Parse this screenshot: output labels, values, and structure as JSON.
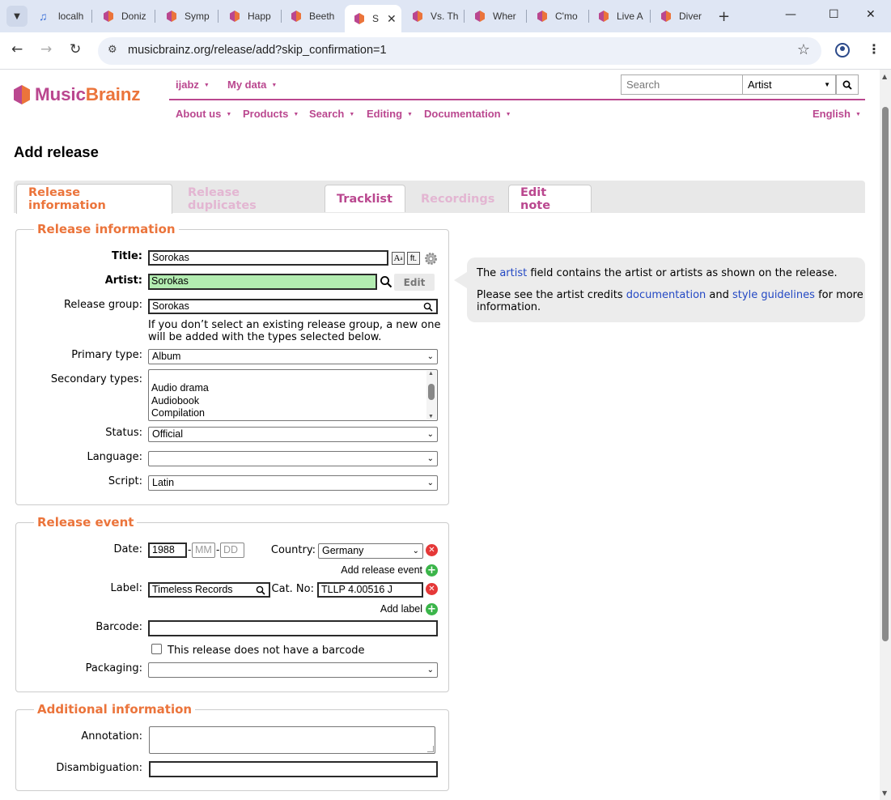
{
  "browser": {
    "tabs": [
      {
        "label": "localh",
        "icon": "music-note-icon"
      },
      {
        "label": "Doniz",
        "icon": "musicbrainz-icon"
      },
      {
        "label": "Symp",
        "icon": "musicbrainz-icon"
      },
      {
        "label": "Happ",
        "icon": "musicbrainz-icon"
      },
      {
        "label": "Beeth",
        "icon": "musicbrainz-icon"
      },
      {
        "label": "S",
        "icon": "musicbrainz-icon",
        "active": true
      },
      {
        "label": "Vs. Th",
        "icon": "musicbrainz-icon"
      },
      {
        "label": "Wher",
        "icon": "musicbrainz-icon"
      },
      {
        "label": "C'mo",
        "icon": "musicbrainz-icon"
      },
      {
        "label": "Live A",
        "icon": "musicbrainz-icon"
      },
      {
        "label": "Diver",
        "icon": "musicbrainz-icon"
      }
    ],
    "url": "musicbrainz.org/release/add?skip_confirmation=1"
  },
  "header": {
    "logo_a": "Music",
    "logo_b": "Brainz",
    "user_menu": "ijabz",
    "mydata_menu": "My data",
    "search_placeholder": "Search",
    "search_type": "Artist",
    "nav": [
      "About us",
      "Products",
      "Search",
      "Editing",
      "Documentation"
    ],
    "language": "English"
  },
  "page": {
    "title": "Add release",
    "tabs": [
      "Release information",
      "Release duplicates",
      "Tracklist",
      "Recordings",
      "Edit note"
    ]
  },
  "release_info": {
    "legend": "Release information",
    "title_label": "Title:",
    "title_value": "Sorokas",
    "artist_label": "Artist:",
    "artist_value": "Sorokas",
    "edit_button": "Edit",
    "release_group_label": "Release group:",
    "release_group_value": "Sorokas",
    "release_group_note_1": "If you don’t select an existing release group, a new one",
    "release_group_note_2": "will be added with the types selected below.",
    "primary_type_label": "Primary type:",
    "primary_type_value": "Album",
    "secondary_types_label": "Secondary types:",
    "secondary_types_options": [
      "Audio drama",
      "Audiobook",
      "Compilation"
    ],
    "status_label": "Status:",
    "status_value": "Official",
    "language_label": "Language:",
    "language_value": "",
    "script_label": "Script:",
    "script_value": "Latin"
  },
  "help_bubble": {
    "line1_a": "The",
    "line1_link": "artist",
    "line1_b": "field contains the artist or artists as shown on the release.",
    "line2_a": "Please see the artist credits",
    "line2_link1": "documentation",
    "line2_and": "and",
    "line2_link2": "style guidelines",
    "line2_b": "for more",
    "line3": "information."
  },
  "release_event": {
    "legend": "Release event",
    "date_label": "Date:",
    "year": "1988",
    "month_placeholder": "MM",
    "day_placeholder": "DD",
    "country_label": "Country:",
    "country_value": "Germany",
    "add_event": "Add release event",
    "label_label": "Label:",
    "label_value": "Timeless Records",
    "catno_label": "Cat. No:",
    "catno_value": "TLLP 4.00516 J",
    "add_label": "Add label",
    "barcode_label": "Barcode:",
    "barcode_value": "",
    "no_barcode": "This release does not have a barcode",
    "packaging_label": "Packaging:",
    "packaging_value": ""
  },
  "additional_info": {
    "legend": "Additional information",
    "annotation_label": "Annotation:",
    "disambiguation_label": "Disambiguation:"
  },
  "colors": {
    "brand_purple": "#ba478f",
    "brand_orange": "#eb743b",
    "artist_field_bg": "#b3ecb1"
  }
}
